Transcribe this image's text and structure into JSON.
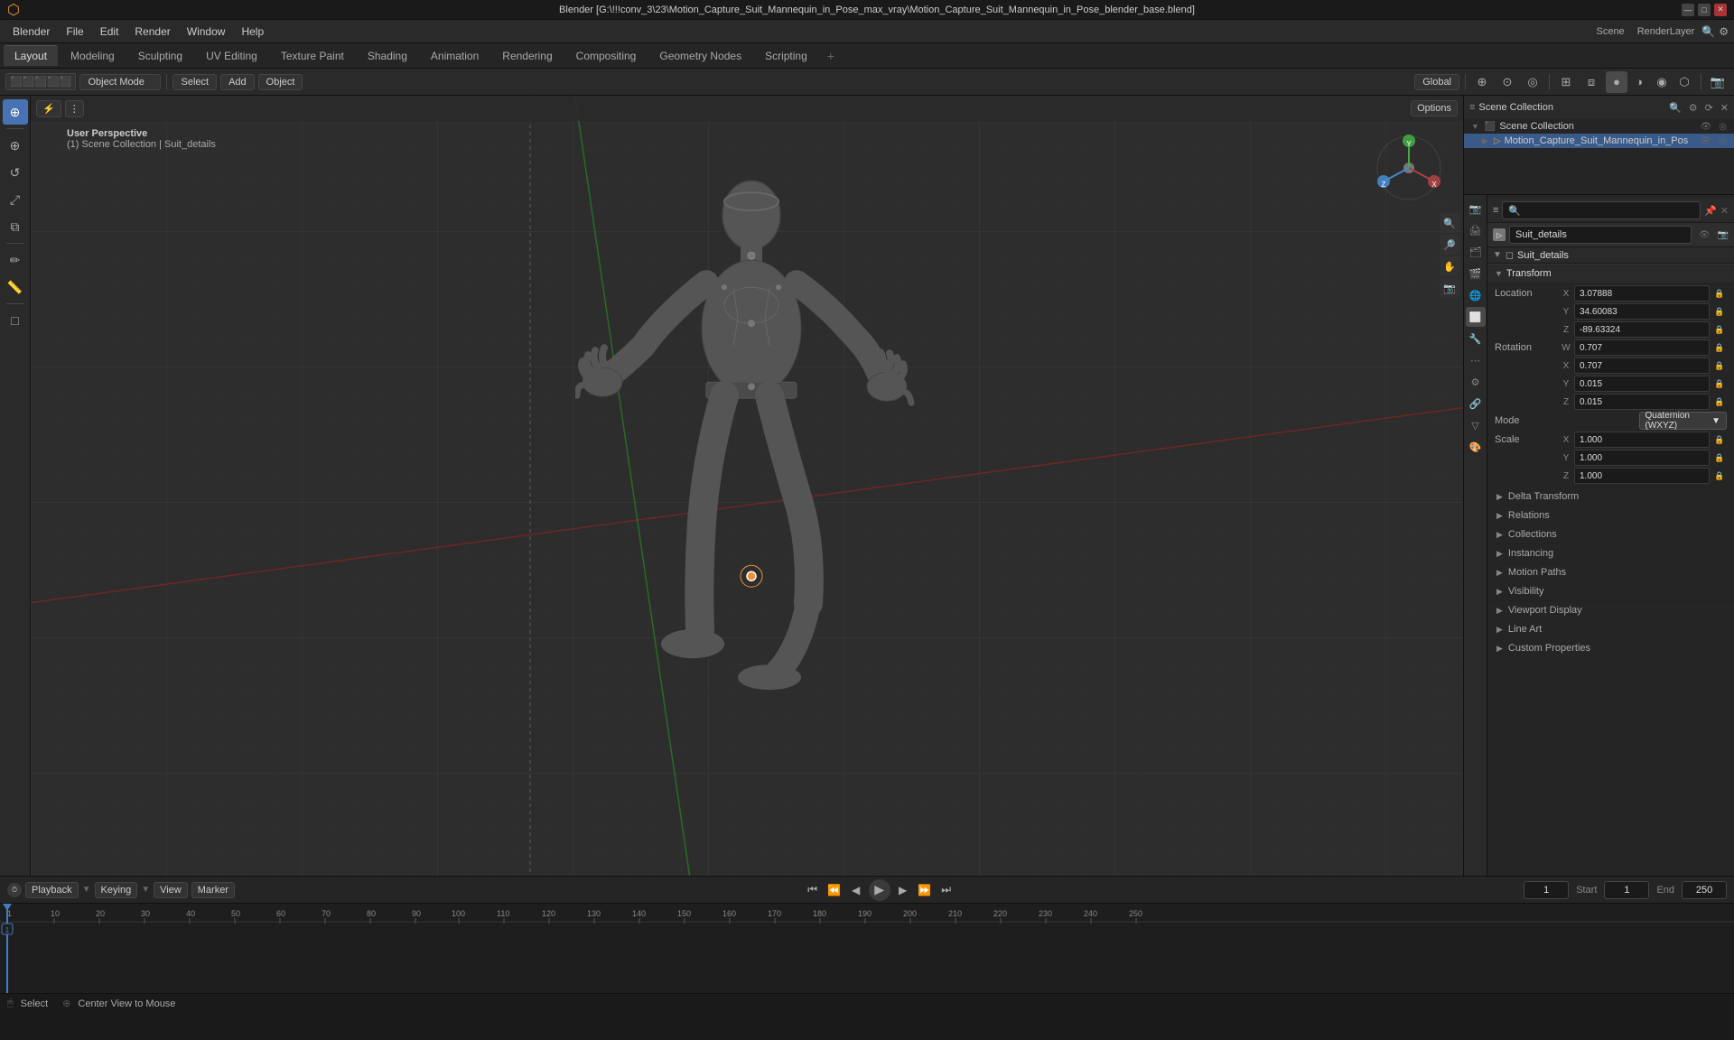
{
  "window": {
    "title": "Blender [G:\\!!!conv_3\\23\\Motion_Capture_Suit_Mannequin_in_Pose_max_vray\\Motion_Capture_Suit_Mannequin_in_Pose_blender_base.blend]",
    "controls": [
      "—",
      "□",
      "✕"
    ]
  },
  "menubar": {
    "items": [
      "Blender",
      "File",
      "Edit",
      "Render",
      "Window",
      "Help"
    ]
  },
  "workspace_tabs": {
    "tabs": [
      "Layout",
      "Modeling",
      "Sculpting",
      "UV Editing",
      "Texture Paint",
      "Shading",
      "Animation",
      "Rendering",
      "Compositing",
      "Geometry Nodes",
      "Scripting"
    ],
    "active": "Layout",
    "plus": "+"
  },
  "top_toolbar": {
    "mode": "Object Mode",
    "select_label": "Select",
    "add_label": "Add",
    "object_label": "Object",
    "global_label": "Global",
    "options_label": "Options"
  },
  "viewport": {
    "mode_label": "User Perspective",
    "collection_label": "(1) Scene Collection | Suit_details",
    "nav": {
      "x_label": "X",
      "y_label": "Y",
      "z_label": "Z"
    }
  },
  "left_tools": {
    "items": [
      "⊕",
      "↕",
      "↺",
      "⤢",
      "⊙",
      "✏",
      "◻",
      "⊞"
    ]
  },
  "outliner": {
    "header": {
      "title": "Scene Collection"
    },
    "items": [
      {
        "name": "Motion_Capture_Suit_Mannequin_in_Pos",
        "icon": "▷",
        "expanded": true
      }
    ]
  },
  "properties": {
    "object_name": "Suit_details",
    "object_name2": "Suit_details",
    "transform": {
      "title": "Transform",
      "location": {
        "label": "Location",
        "x_label": "X",
        "x_value": "3.07888",
        "y_label": "Y",
        "y_value": "34.60083",
        "z_label": "Z",
        "z_value": "-89.63324"
      },
      "rotation": {
        "label": "Rotation",
        "w_label": "W",
        "w_value": "0.707",
        "x_label": "X",
        "x_value": "0.707",
        "y_label": "Y",
        "y_value": "0.015",
        "z_label": "Z",
        "z_value": "0.015",
        "mode_label": "Mode",
        "mode_value": "Quaternion (WXYZ)"
      },
      "scale": {
        "label": "Scale",
        "x_label": "X",
        "x_value": "1.000",
        "y_label": "Y",
        "y_value": "1.000",
        "z_label": "Z",
        "z_value": "1.000"
      }
    },
    "sections": [
      {
        "id": "delta_transform",
        "label": "Delta Transform",
        "collapsed": true
      },
      {
        "id": "relations",
        "label": "Relations",
        "collapsed": true
      },
      {
        "id": "collections",
        "label": "Collections",
        "collapsed": true
      },
      {
        "id": "instancing",
        "label": "Instancing",
        "collapsed": true
      },
      {
        "id": "motion_paths",
        "label": "Motion Paths",
        "collapsed": true
      },
      {
        "id": "visibility",
        "label": "Visibility",
        "collapsed": true
      },
      {
        "id": "viewport_display",
        "label": "Viewport Display",
        "collapsed": true
      },
      {
        "id": "line_art",
        "label": "Line Art",
        "collapsed": true
      },
      {
        "id": "custom_properties",
        "label": "Custom Properties",
        "collapsed": true
      }
    ],
    "prop_icons": [
      "🎬",
      "🔗",
      "📐",
      "💡",
      "🌐",
      "🎨",
      "⚙",
      "🔧",
      "📷"
    ]
  },
  "timeline": {
    "playback_label": "Playback",
    "keying_label": "Keying",
    "view_label": "View",
    "marker_label": "Marker",
    "start_label": "Start",
    "end_label": "End",
    "start_value": "1",
    "end_value": "250",
    "current_frame": "1",
    "frame_marks": [
      "1",
      "10",
      "20",
      "30",
      "40",
      "50",
      "60",
      "70",
      "80",
      "90",
      "100",
      "110",
      "120",
      "130",
      "140",
      "150",
      "160",
      "170",
      "180",
      "190",
      "200",
      "210",
      "220",
      "230",
      "240",
      "250"
    ]
  },
  "status_bar": {
    "select_label": "Select",
    "center_view_label": "Center View to Mouse"
  },
  "colors": {
    "accent_blue": "#4772b3",
    "x_axis": "#cc4444",
    "y_axis": "#44cc44",
    "z_axis": "#4488cc",
    "active_orange": "#e8923a"
  }
}
